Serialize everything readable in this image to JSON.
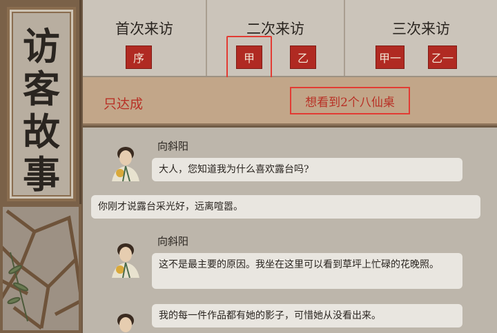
{
  "title_chars": [
    "访",
    "客",
    "故",
    "事"
  ],
  "tabs": [
    {
      "title": "首次来访",
      "buttons": [
        "序"
      ]
    },
    {
      "title": "二次来访",
      "buttons": [
        "甲",
        "乙"
      ]
    },
    {
      "title": "三次来访",
      "buttons": [
        "甲一",
        "乙一"
      ]
    }
  ],
  "condition": {
    "left": "只达成",
    "right": "想看到2个八仙桌"
  },
  "dialogue": [
    {
      "speaker": "向斜阳",
      "text": "大人，您知道我为什么喜欢露台吗?"
    },
    {
      "speaker": "",
      "text": "你刚才说露台采光好，远离喧嚣。"
    },
    {
      "speaker": "向斜阳",
      "text": "这不是最主要的原因。我坐在这里可以看到草坪上忙碌的花晚照。"
    },
    {
      "speaker": "",
      "text": "我的每一件作品都有她的影子，可惜她从没看出来。"
    }
  ],
  "colors": {
    "accent_red": "#b02a22",
    "highlight_red": "#e23b33",
    "frame_brown": "#8a6d4f"
  }
}
